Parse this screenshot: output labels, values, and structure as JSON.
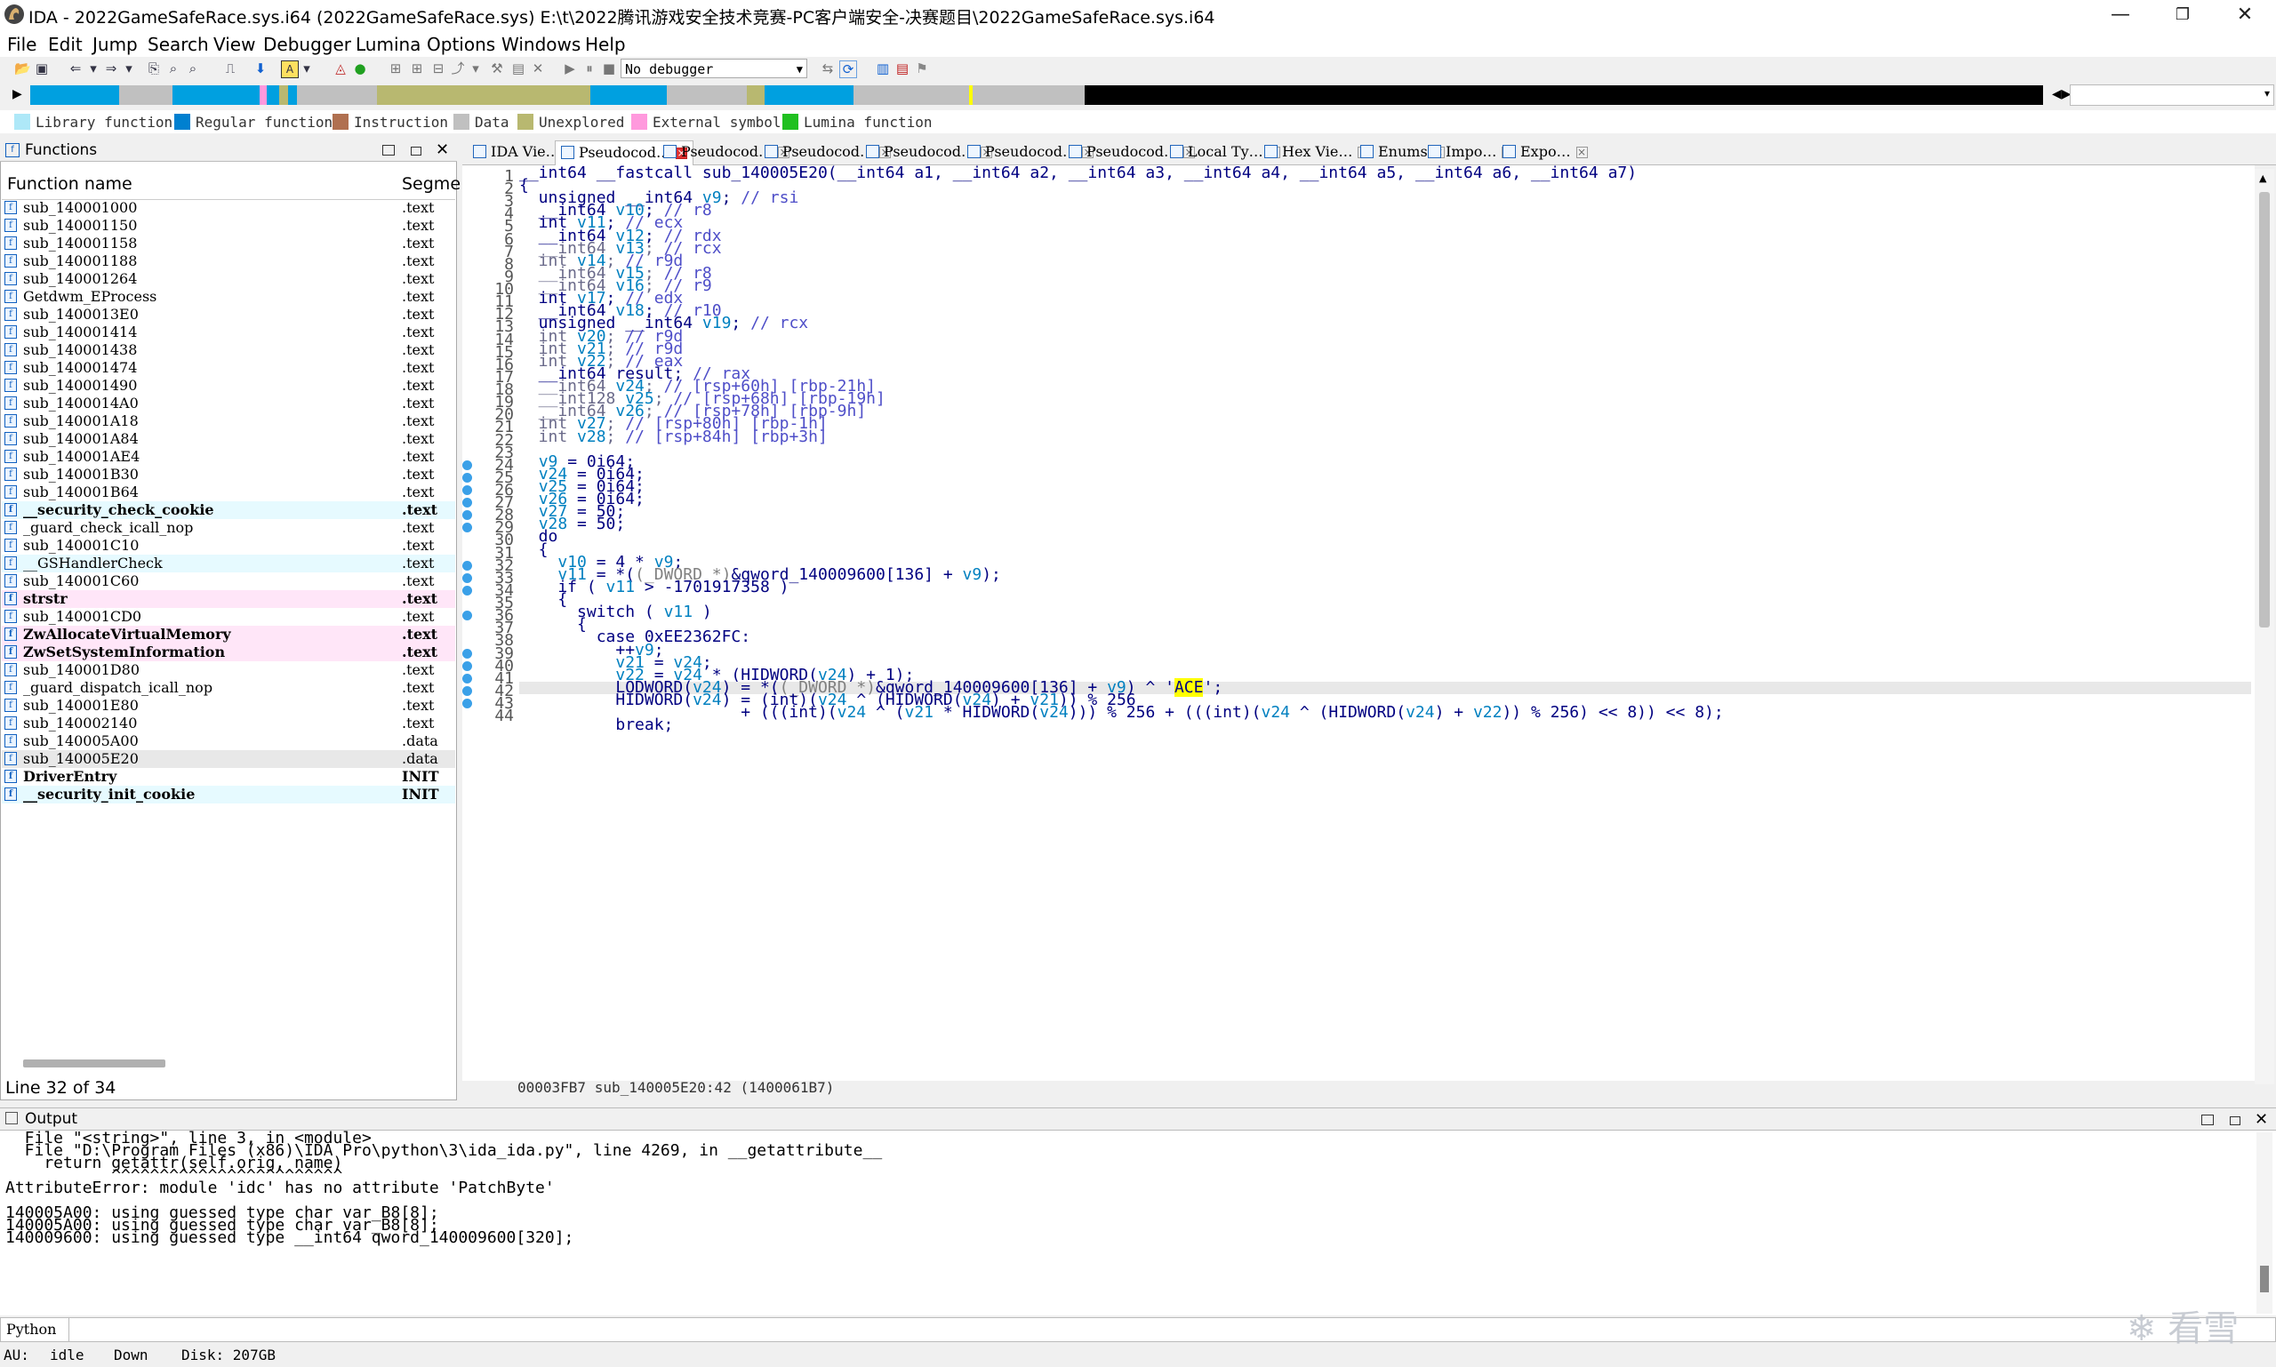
{
  "window": {
    "title": "IDA - 2022GameSafeRace.sys.i64 (2022GameSafeRace.sys) E:\\t\\2022腾讯游戏安全技术竞赛-PC客户端安全-决赛题目\\2022GameSafeRace.sys.i64",
    "minimize": "—",
    "maximize": "❐",
    "close": "✕"
  },
  "menu": [
    "File",
    "Edit",
    "Jump",
    "Search",
    "View",
    "Debugger",
    "Lumina",
    "Options",
    "Windows",
    "Help"
  ],
  "toolbar": {
    "debugger": "No debugger"
  },
  "legend": [
    {
      "label": "Library function",
      "color": "#aee8f8"
    },
    {
      "label": "Regular function",
      "color": "#0080d0"
    },
    {
      "label": "Instruction",
      "color": "#b07050"
    },
    {
      "label": "Data",
      "color": "#c0c0c0"
    },
    {
      "label": "Unexplored",
      "color": "#b8b870"
    },
    {
      "label": "External symbol",
      "color": "#ff99dd"
    },
    {
      "label": "Lumina function",
      "color": "#20c020"
    }
  ],
  "functions": {
    "title": "Functions",
    "col_name": "Function name",
    "col_segment": "Segme",
    "rows": [
      {
        "name": "sub_140001000",
        "seg": ".text",
        "type": "reg"
      },
      {
        "name": "sub_140001150",
        "seg": ".text",
        "type": "reg"
      },
      {
        "name": "sub_140001158",
        "seg": ".text",
        "type": "reg"
      },
      {
        "name": "sub_140001188",
        "seg": ".text",
        "type": "reg"
      },
      {
        "name": "sub_140001264",
        "seg": ".text",
        "type": "reg"
      },
      {
        "name": "Getdwm_EProcess",
        "seg": ".text",
        "type": "reg"
      },
      {
        "name": "sub_1400013E0",
        "seg": ".text",
        "type": "reg"
      },
      {
        "name": "sub_140001414",
        "seg": ".text",
        "type": "reg"
      },
      {
        "name": "sub_140001438",
        "seg": ".text",
        "type": "reg"
      },
      {
        "name": "sub_140001474",
        "seg": ".text",
        "type": "reg"
      },
      {
        "name": "sub_140001490",
        "seg": ".text",
        "type": "reg"
      },
      {
        "name": "sub_1400014A0",
        "seg": ".text",
        "type": "reg"
      },
      {
        "name": "sub_140001A18",
        "seg": ".text",
        "type": "reg"
      },
      {
        "name": "sub_140001A84",
        "seg": ".text",
        "type": "reg"
      },
      {
        "name": "sub_140001AE4",
        "seg": ".text",
        "type": "reg"
      },
      {
        "name": "sub_140001B30",
        "seg": ".text",
        "type": "reg"
      },
      {
        "name": "sub_140001B64",
        "seg": ".text",
        "type": "reg"
      },
      {
        "name": "__security_check_cookie",
        "seg": ".text",
        "type": "lib"
      },
      {
        "name": "_guard_check_icall_nop",
        "seg": ".text",
        "type": "reg"
      },
      {
        "name": "sub_140001C10",
        "seg": ".text",
        "type": "reg"
      },
      {
        "name": "__GSHandlerCheck",
        "seg": ".text",
        "type": "libn"
      },
      {
        "name": "sub_140001C60",
        "seg": ".text",
        "type": "reg"
      },
      {
        "name": "strstr",
        "seg": ".text",
        "type": "ext"
      },
      {
        "name": "sub_140001CD0",
        "seg": ".text",
        "type": "reg"
      },
      {
        "name": "ZwAllocateVirtualMemory",
        "seg": ".text",
        "type": "ext"
      },
      {
        "name": "ZwSetSystemInformation",
        "seg": ".text",
        "type": "ext"
      },
      {
        "name": "sub_140001D80",
        "seg": ".text",
        "type": "reg"
      },
      {
        "name": "_guard_dispatch_icall_nop",
        "seg": ".text",
        "type": "reg"
      },
      {
        "name": "sub_140001E80",
        "seg": ".text",
        "type": "reg"
      },
      {
        "name": "sub_140002140",
        "seg": ".text",
        "type": "reg"
      },
      {
        "name": "sub_140005A00",
        "seg": ".data",
        "type": "reg"
      },
      {
        "name": "sub_140005E20",
        "seg": ".data",
        "type": "sel"
      },
      {
        "name": "DriverEntry",
        "seg": "INIT",
        "type": "bold"
      },
      {
        "name": "__security_init_cookie",
        "seg": "INIT",
        "type": "lib"
      }
    ],
    "status": "Line 32 of 34"
  },
  "tabs": [
    {
      "label": "IDA Vie…",
      "active": false
    },
    {
      "label": "Pseudocod…",
      "active": true
    },
    {
      "label": "Pseudocod…",
      "active": false
    },
    {
      "label": "Pseudocod…",
      "active": false
    },
    {
      "label": "Pseudocod…",
      "active": false
    },
    {
      "label": "Pseudocod…",
      "active": false
    },
    {
      "label": "Pseudocod…",
      "active": false
    },
    {
      "label": "Local Ty…",
      "active": false
    },
    {
      "label": "Hex Vie…",
      "active": false
    },
    {
      "label": "Enums",
      "active": false
    },
    {
      "label": "Impo…",
      "active": false
    },
    {
      "label": "Expo…",
      "active": false
    }
  ],
  "code": {
    "lines": [
      {
        "n": "1",
        "t": "__int64 __fastcall sub_140005E20(__int64 a1, __int64 a2, __int64 a3, __int64 a4, __int64 a5, __int64 a6, __int64 a7)",
        "bp": false
      },
      {
        "n": "2",
        "t": "{",
        "bp": false
      },
      {
        "n": "3",
        "t": "  unsigned __int64 v9; // rsi",
        "bp": false
      },
      {
        "n": "4",
        "t": "  __int64 v10; // r8",
        "bp": false
      },
      {
        "n": "5",
        "t": "  int v11; // ecx",
        "bp": false
      },
      {
        "n": "6",
        "t": "  __int64 v12; // rdx",
        "bp": false
      },
      {
        "n": "7",
        "t": "  __int64 v13; // rcx",
        "bp": false
      },
      {
        "n": "8",
        "t": "  int v14; // r9d",
        "bp": false
      },
      {
        "n": "9",
        "t": "  __int64 v15; // r8",
        "bp": false
      },
      {
        "n": "10",
        "t": "  __int64 v16; // r9",
        "bp": false
      },
      {
        "n": "11",
        "t": "  int v17; // edx",
        "bp": false
      },
      {
        "n": "12",
        "t": "  __int64 v18; // r10",
        "bp": false
      },
      {
        "n": "13",
        "t": "  unsigned __int64 v19; // rcx",
        "bp": false
      },
      {
        "n": "14",
        "t": "  int v20; // r9d",
        "bp": false
      },
      {
        "n": "15",
        "t": "  int v21; // r9d",
        "bp": false
      },
      {
        "n": "16",
        "t": "  int v22; // eax",
        "bp": false
      },
      {
        "n": "17",
        "t": "  __int64 result; // rax",
        "bp": false
      },
      {
        "n": "18",
        "t": "  __int64 v24; // [rsp+60h] [rbp-21h]",
        "bp": false
      },
      {
        "n": "19",
        "t": "  __int128 v25; // [rsp+68h] [rbp-19h]",
        "bp": false
      },
      {
        "n": "20",
        "t": "  __int64 v26; // [rsp+78h] [rbp-9h]",
        "bp": false
      },
      {
        "n": "21",
        "t": "  int v27; // [rsp+80h] [rbp-1h]",
        "bp": false
      },
      {
        "n": "22",
        "t": "  int v28; // [rsp+84h] [rbp+3h]",
        "bp": false
      },
      {
        "n": "23",
        "t": "",
        "bp": false
      },
      {
        "n": "24",
        "t": "  v9 = 0i64;",
        "bp": true
      },
      {
        "n": "25",
        "t": "  v24 = 0i64;",
        "bp": true
      },
      {
        "n": "26",
        "t": "  v25 = 0i64;",
        "bp": true
      },
      {
        "n": "27",
        "t": "  v26 = 0i64;",
        "bp": true
      },
      {
        "n": "28",
        "t": "  v27 = 50;",
        "bp": true
      },
      {
        "n": "29",
        "t": "  v28 = 50;",
        "bp": true
      },
      {
        "n": "30",
        "t": "  do",
        "bp": false
      },
      {
        "n": "31",
        "t": "  {",
        "bp": false
      },
      {
        "n": "32",
        "t": "    v10 = 4 * v9;",
        "bp": true
      },
      {
        "n": "33",
        "t": "    v11 = *((_DWORD *)&qword_140009600[136] + v9);",
        "bp": true
      },
      {
        "n": "34",
        "t": "    if ( v11 > -1701917358 )",
        "bp": true
      },
      {
        "n": "35",
        "t": "    {",
        "bp": false
      },
      {
        "n": "36",
        "t": "      switch ( v11 )",
        "bp": true
      },
      {
        "n": "37",
        "t": "      {",
        "bp": false
      },
      {
        "n": "38",
        "t": "        case 0xEE2362FC:",
        "bp": false
      },
      {
        "n": "39",
        "t": "          ++v9;",
        "bp": true
      },
      {
        "n": "40",
        "t": "          v21 = v24;",
        "bp": true
      },
      {
        "n": "41",
        "t": "          v22 = v24 * (HIDWORD(v24) + 1);",
        "bp": true
      },
      {
        "n": "42",
        "t": "          LODWORD(v24) = *((_DWORD *)&qword_140009600[136] + v9) ^ 'ACE';",
        "bp": true
      },
      {
        "n": "43",
        "t": "          HIDWORD(v24) = (int)(v24 ^ (HIDWORD(v24) + v21)) % 256",
        "bp": true
      },
      {
        "n": "44",
        "t": "                       + (((int)(v24 ^ (v21 * HIDWORD(v24))) % 256 + (((int)(v24 ^ (HIDWORD(v24) + v22)) % 256) << 8)) << 8);",
        "bp": false
      },
      {
        "n": "",
        "t": "          break;",
        "bp": false
      }
    ],
    "status": "00003FB7 sub_140005E20:42 (1400061B7)"
  },
  "output": {
    "title": "Output",
    "lines": [
      "  File \"<string>\", line 3, in <module>",
      "  File \"D:\\Program Files (x86)\\IDA Pro\\python\\3\\ida_ida.py\", line 4269, in __getattribute__",
      "    return getattr(self.orig, name)",
      "           ^^^^^^^^^^^^^^^^^^^^^^^^",
      "AttributeError: module 'idc' has no attribute 'PatchByte'",
      "",
      "140005A00: using guessed type char var_B8[8];",
      "140005A00: using guessed type char var_B8[8];",
      "140009600: using guessed type __int64 qword_140009600[320];"
    ]
  },
  "python_label": "Python",
  "status": {
    "au": "AU:",
    "state": "idle",
    "dir": "Down",
    "disk": "Disk: 207GB"
  },
  "watermark": "看雪"
}
